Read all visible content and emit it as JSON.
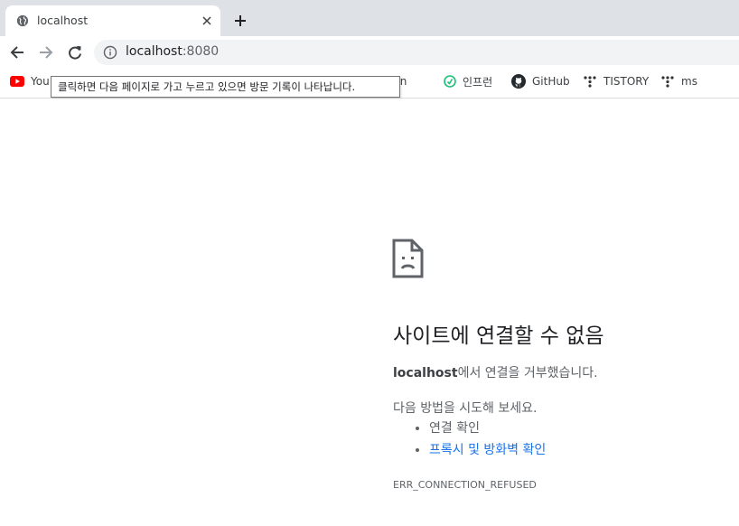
{
  "tab": {
    "title": "localhost",
    "favicon": "globe-icon",
    "close_icon": "close-icon",
    "new_tab_icon": "plus-icon"
  },
  "toolbar": {
    "back_icon": "arrow-left-icon",
    "forward_icon": "arrow-right-icon",
    "reload_icon": "reload-icon",
    "site_info_icon": "info-icon",
    "url_host": "localhost",
    "url_port": ":8080"
  },
  "bookmarks": [
    {
      "label": "You",
      "icon": "youtube-icon",
      "color": "#ff0000"
    },
    {
      "label": "otion",
      "icon": "notion-icon",
      "color": "#000000"
    },
    {
      "label": "인프런",
      "icon": "inflearn-icon",
      "color": "#1dc078"
    },
    {
      "label": "GitHub",
      "icon": "github-icon",
      "color": "#24292e"
    },
    {
      "label": "TISTORY",
      "icon": "tistory-icon",
      "color": "#333333"
    },
    {
      "label": "ms",
      "icon": "tistory-icon",
      "color": "#333333"
    }
  ],
  "tooltip": "클릭하면 다음 페이지로 가고 누르고 있으면 방문 기록이 나타납니다.",
  "error": {
    "icon": "sad-page-icon",
    "title": "사이트에 연결할 수 없음",
    "host": "localhost",
    "description_suffix": "에서 연결을 거부했습니다.",
    "try_label": "다음 방법을 시도해 보세요.",
    "suggestions": [
      "연결 확인",
      "프록시 및 방화벽 확인"
    ],
    "code": "ERR_CONNECTION_REFUSED"
  },
  "colors": {
    "tabstrip": "#dee1e6",
    "link": "#1a73e8",
    "omnibox": "#f1f3f4"
  }
}
